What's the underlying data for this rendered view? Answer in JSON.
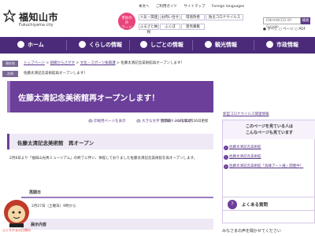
{
  "header": {
    "title": "福知山市",
    "subtitle": "Fukuchiyama city",
    "help_circle": "市民の\n声\nワード",
    "top_links": [
      "本文へ",
      "ご利用ガイド",
      "サイトマップ",
      "Foreign languages"
    ],
    "quick_buttons": [
      "人気・関連",
      "お問い合せ",
      "環境改善",
      "防災コロナウイルス",
      "ふるさと納税",
      "ふくぼ",
      "意見募集"
    ],
    "search_placeholder": "ENHANCED BY Google",
    "search_button": "検索",
    "radio_all": "すべて",
    "radio_page": "ページ",
    "radio_pdf": "PDF"
  },
  "nav": {
    "items": [
      "ホーム",
      "くらしの情報",
      "しごとの情報",
      "観光情報",
      "市政情報"
    ]
  },
  "breadcrumb": {
    "tag_current": "現在地",
    "path": [
      "トップページ",
      "組織からさがす",
      "文化・スポーツ振興課"
    ],
    "current": "佐藤太清記念美術館再オープンします！",
    "tag_news": "お知",
    "news_text": "佐藤太清記念美術館再オープンします！"
  },
  "main": {
    "page_title": "佐藤太清記念美術館再オープンします！",
    "print_link": "印刷用ページを表示",
    "large_print_link": "大きな文字で印刷ページを表示",
    "updated": "更新日：2021年2月26日更新",
    "section_title": "佐藤太清記念美術館　再オープン",
    "paragraph": "2月8日より「福知山光秀ミュージアム」の終了に伴い、休館しておりました佐藤太清記念美術館を再オープンします。",
    "h3": "再開日",
    "date": "2月27日（土曜日）9時から",
    "h4": "展示内容"
  },
  "mascot": {
    "label": "ふくちやまの日常の"
  },
  "sidebar": {
    "covid_link": "新型コロナウイルス関連情報",
    "helpful_title": "このページを見ている人は\nこんなページも見ています",
    "links": [
      "佐藤太清記念美術館",
      "佐藤太清記念美術館",
      "佐藤太清記念美術館「高峰アート展」開催中！"
    ],
    "faq": "よくある質問",
    "voice": "みなさまの声を聞かせてください"
  },
  "colors": {
    "primary": "#4b2a7a",
    "title_bg": "#6b3f9a",
    "accent_pink": "#e8447a"
  }
}
